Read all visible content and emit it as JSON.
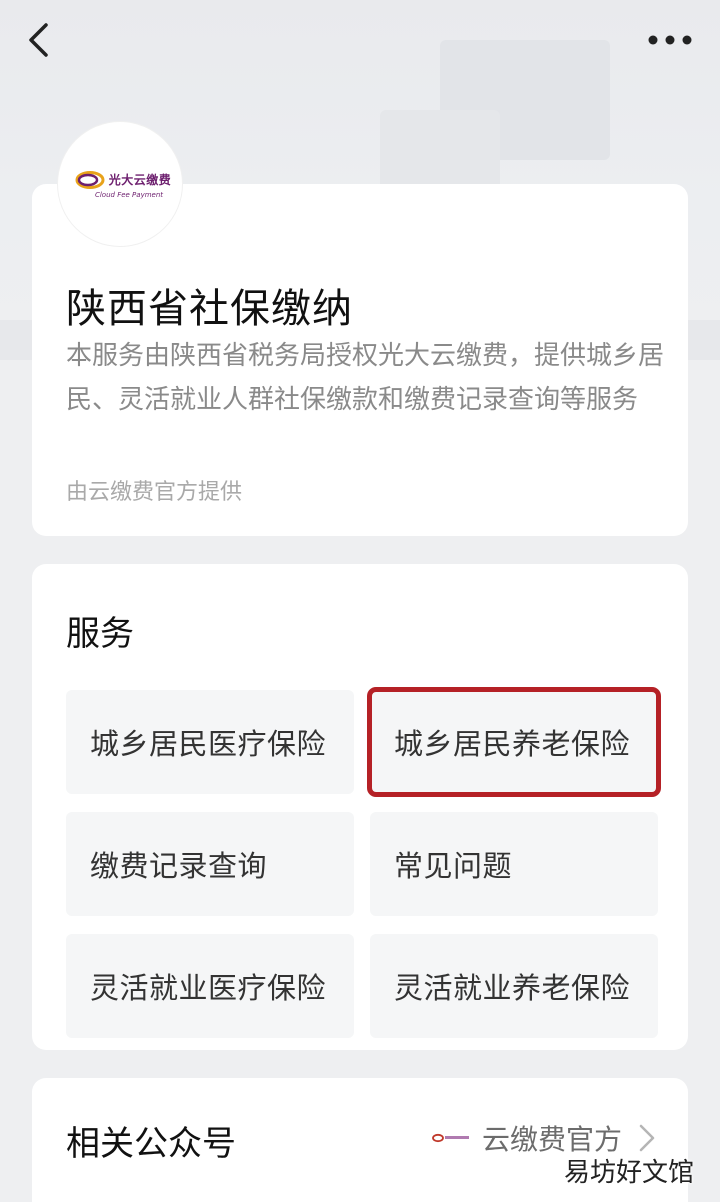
{
  "intro": {
    "logo": {
      "text": "光大云缴费",
      "subtext": "Cloud Fee Payment",
      "brand_color": "#6d1f6e"
    },
    "title": "陕西省社保缴纳",
    "description": "本服务由陕西省税务局授权光大云缴费，提供城乡居民、灵活就业人群社保缴款和缴费记录查询等服务",
    "provider": "由云缴费官方提供"
  },
  "services": {
    "title": "服务",
    "items": [
      {
        "label": "城乡居民医疗保险"
      },
      {
        "label": "城乡居民养老保险",
        "highlighted": true
      },
      {
        "label": "缴费记录查询"
      },
      {
        "label": "常见问题"
      },
      {
        "label": "灵活就业医疗保险"
      },
      {
        "label": "灵活就业养老保险"
      }
    ]
  },
  "related": {
    "title": "相关公众号",
    "account_name": "云缴费官方"
  },
  "watermark": "易坊好文馆",
  "icons": {
    "back": "chevron-left-icon",
    "more": "more-dots-icon",
    "arrow": "chevron-right-icon"
  },
  "colors": {
    "highlight": "#b52126"
  }
}
